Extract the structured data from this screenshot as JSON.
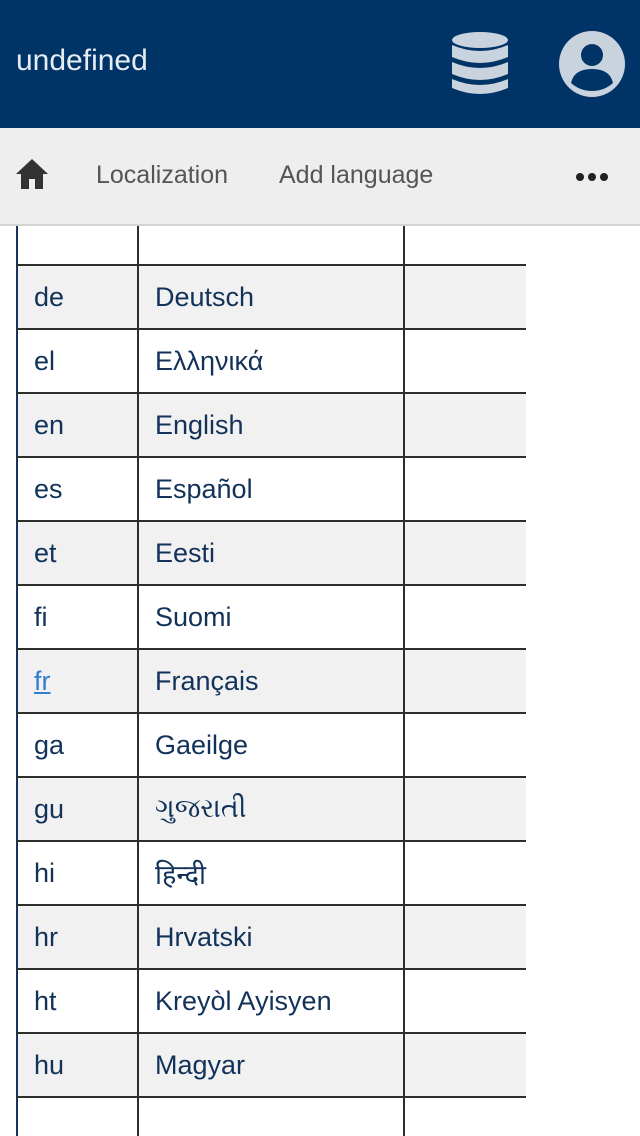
{
  "header": {
    "title": "undefined",
    "bg_color": "#003366",
    "icons": [
      "database-icon",
      "account-circle-icon"
    ]
  },
  "nav": {
    "home_icon": "home-icon",
    "items": [
      {
        "label": "Localization"
      },
      {
        "label": "Add language"
      }
    ],
    "more_icon": "more-horizontal-icon"
  },
  "table": {
    "rows": [
      {
        "code": "",
        "name": "",
        "link": false
      },
      {
        "code": "de",
        "name": "Deutsch",
        "link": false
      },
      {
        "code": "el",
        "name": "Ελληνικά",
        "link": false
      },
      {
        "code": "en",
        "name": "English",
        "link": false
      },
      {
        "code": "es",
        "name": "Español",
        "link": false
      },
      {
        "code": "et",
        "name": "Eesti",
        "link": false
      },
      {
        "code": "fi",
        "name": "Suomi",
        "link": false
      },
      {
        "code": "fr",
        "name": "Français",
        "link": true
      },
      {
        "code": "ga",
        "name": "Gaeilge",
        "link": false
      },
      {
        "code": "gu",
        "name": "ગુજરાતી",
        "link": false
      },
      {
        "code": "hi",
        "name": "हिन्दी",
        "link": false
      },
      {
        "code": "hr",
        "name": "Hrvatski",
        "link": false
      },
      {
        "code": "ht",
        "name": "Kreyòl Ayisyen",
        "link": false
      },
      {
        "code": "hu",
        "name": "Magyar",
        "link": false
      },
      {
        "code": "",
        "name": "",
        "link": false
      }
    ],
    "link_color": "#2f7fd0",
    "text_color": "#12325a"
  }
}
